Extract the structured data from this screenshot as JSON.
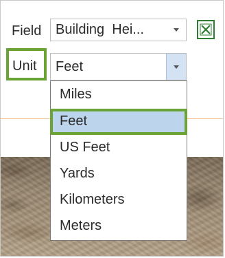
{
  "field": {
    "label": "Field",
    "selected_value": "Building  Hei..."
  },
  "unit": {
    "label": "Unit",
    "selected_value": "Feet",
    "options": [
      "Miles",
      "Feet",
      "US Feet",
      "Yards",
      "Kilometers",
      "Meters"
    ],
    "highlighted_option": "Feet"
  },
  "icons": {
    "field_dropdown": "chevron-down-icon",
    "unit_dropdown": "chevron-down-icon",
    "excel": "excel-icon"
  },
  "colors": {
    "highlight_outline": "#6aa437",
    "selected_option_bg": "#bcd4ec",
    "dropdown_button_bg": "#d3e3f3",
    "excel_green": "#2e7d32",
    "divider_orange": "#f3c69a"
  }
}
